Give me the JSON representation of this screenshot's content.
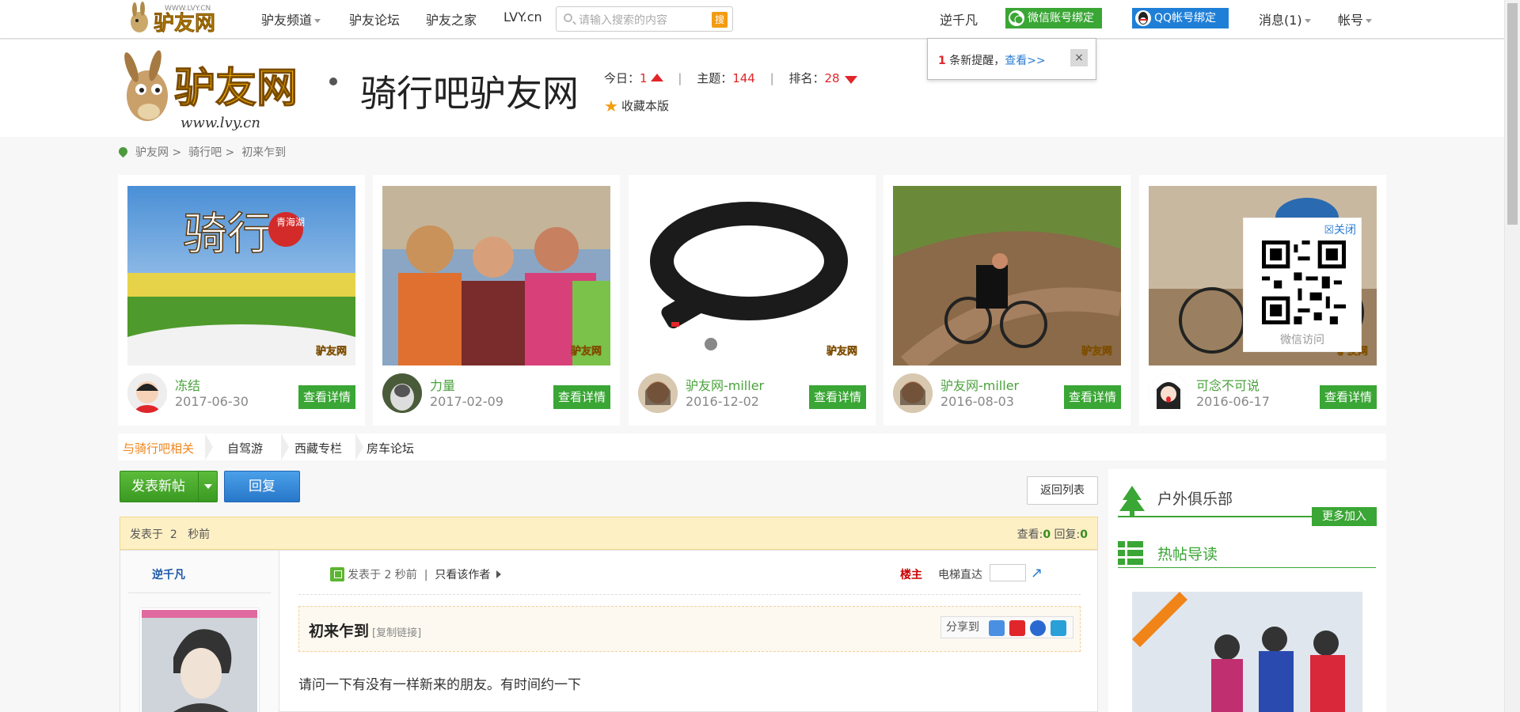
{
  "topbar": {
    "logo_text": "驴友网",
    "logo_url_text": "WWW.LVY.CN",
    "nav": [
      "驴友频道",
      "驴友论坛",
      "驴友之家",
      "LVY.cn"
    ],
    "search_placeholder": "请输入搜索的内容",
    "search_button": "搜",
    "username": "逆千凡",
    "wechat_bind": "微信账号绑定",
    "qq_bind": "QQ帐号绑定",
    "messages": "消息(1)",
    "account": "帐号"
  },
  "header": {
    "logo_text": "驴友网",
    "logo_sub": "www.lvy.cn",
    "forum_name": "骑行吧驴友网",
    "today_label": "今日：",
    "today_value": "1",
    "topics_label": "主题：",
    "topics_value": "144",
    "rank_label": "排名：",
    "rank_value": "28",
    "favorite": "收藏本版"
  },
  "notice": {
    "count": "1",
    "text": "条新提醒，",
    "link": "查看>>",
    "close": "×"
  },
  "breadcrumb": [
    "驴友网 >",
    "骑行吧 >",
    "初来乍到"
  ],
  "cards": [
    {
      "name": "冻结",
      "date": "2017-06-30",
      "button": "查看详情",
      "img_title": "骑行",
      "img_badge": "青海湖"
    },
    {
      "name": "力量",
      "date": "2017-02-09",
      "button": "查看详情"
    },
    {
      "name": "驴友网-miller",
      "date": "2016-12-02",
      "button": "查看详情"
    },
    {
      "name": "驴友网-miller",
      "date": "2016-08-03",
      "button": "查看详情"
    },
    {
      "name": "可念不可说",
      "date": "2016-06-17",
      "button": "查看详情"
    }
  ],
  "watermark": "驴友网",
  "qr": {
    "close": "关闭",
    "label": "微信访问"
  },
  "tabs": [
    "与骑行吧相关",
    "自驾游",
    "西藏专栏",
    "房车论坛"
  ],
  "actions": {
    "new_post": "发表新帖",
    "reply": "回复",
    "back": "返回列表"
  },
  "post": {
    "posted_prefix": "发表于",
    "posted_num": "2",
    "posted_unit": "秒前",
    "views_label": "查看:",
    "views": "0",
    "replies_label": "回复:",
    "replies": "0",
    "author": "逆千凡",
    "meta": "发表于 2 秒前",
    "only_author": "只看该作者",
    "floor": "楼主",
    "elevator": "电梯直达",
    "title": "初来乍到",
    "copy_link": "[复制链接]",
    "share": "分享到",
    "content": "请问一下有没有一样新来的朋友。有时间约一下"
  },
  "sidebar": {
    "club": "户外俱乐部",
    "more": "更多加入",
    "hot": "热帖导读"
  },
  "colors": {
    "green": "#3aa635",
    "red": "#e0262a",
    "orange": "#f08419",
    "blue": "#2a7cd3"
  }
}
